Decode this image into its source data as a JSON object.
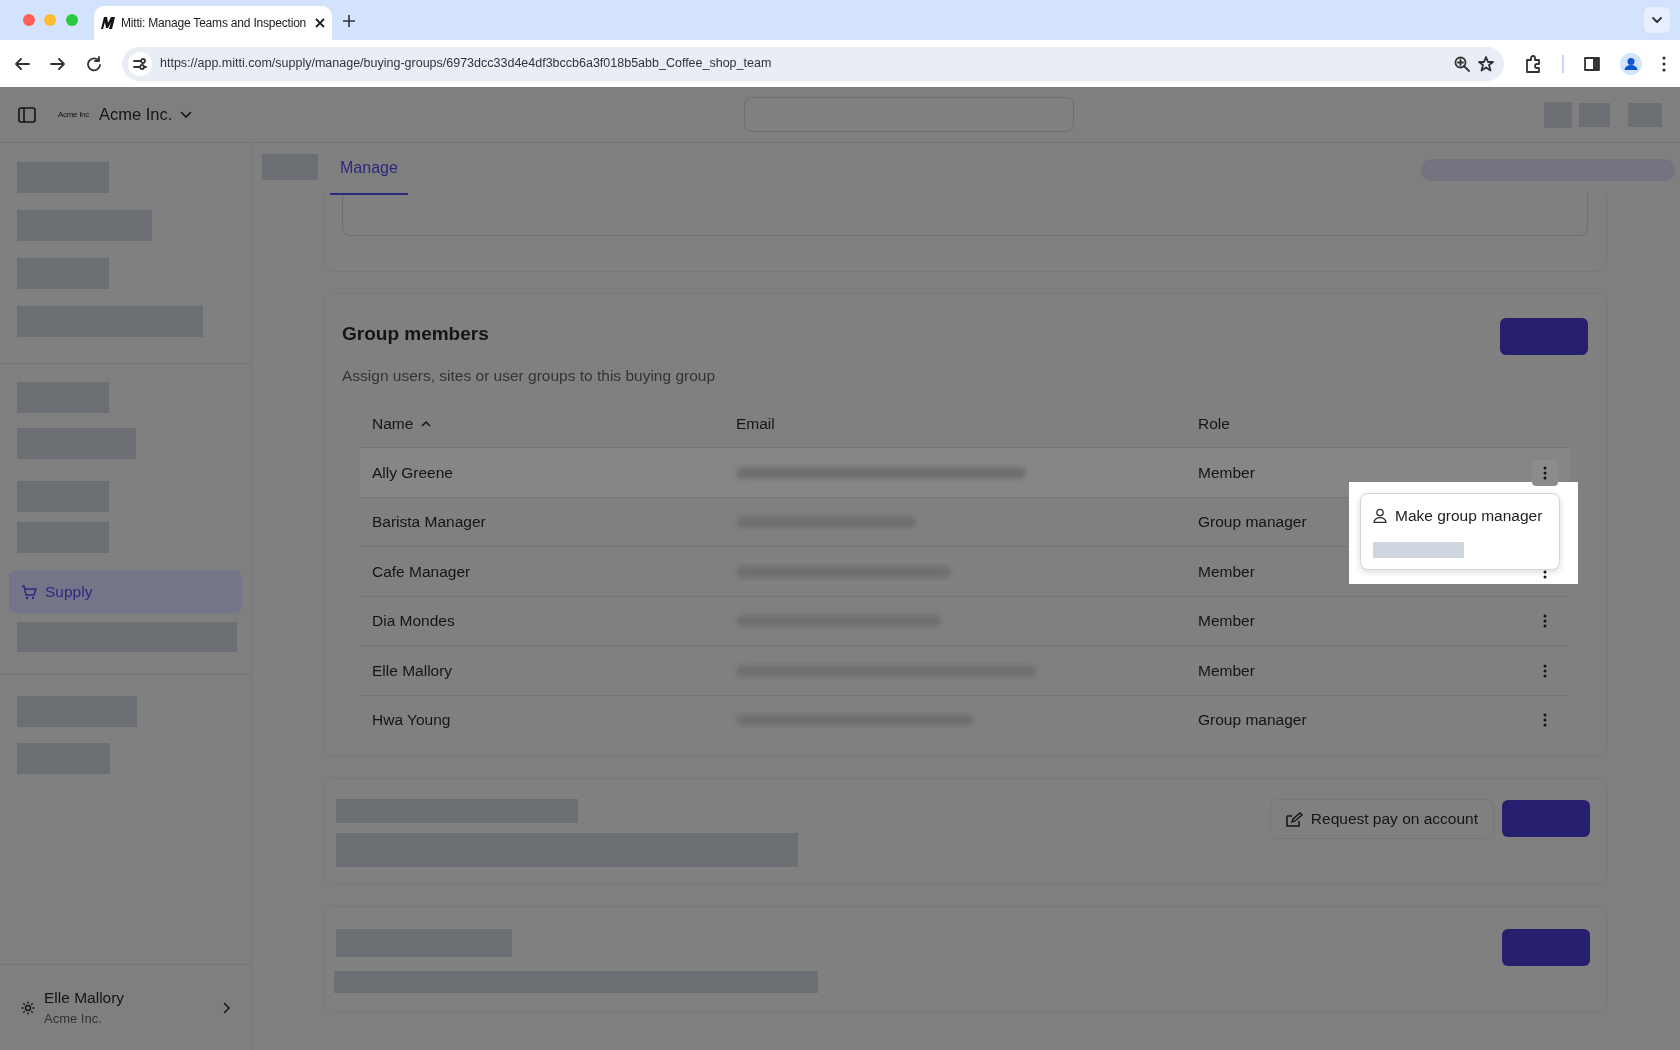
{
  "browser": {
    "tab_title": "Mitti: Manage Teams and Inspection",
    "url": "https://app.mitti.com/supply/manage/buying-groups/6973dcc33d4e4df3bccb6a3f018b5abb_Coffee_shop_team"
  },
  "header": {
    "logo_text": "Acme Inc",
    "org_name": "Acme Inc."
  },
  "sidebar": {
    "items": [
      {
        "label": "Supply",
        "selected": true
      }
    ],
    "user": {
      "name": "Elle Mallory",
      "org": "Acme Inc."
    }
  },
  "tabs": [
    {
      "label": "Manage",
      "selected": true
    }
  ],
  "group_members": {
    "title": "Group members",
    "subtitle": "Assign users, sites or user groups to this buying group",
    "columns": [
      {
        "label": "Name",
        "sorted": true
      },
      {
        "label": "Email",
        "sorted": false
      },
      {
        "label": "Role",
        "sorted": false
      }
    ],
    "rows": [
      {
        "name": "Ally Greene",
        "role": "Member",
        "menu_open": true
      },
      {
        "name": "Barista Manager",
        "role": "Group manager",
        "menu_open": false
      },
      {
        "name": "Cafe Manager",
        "role": "Member",
        "menu_open": false
      },
      {
        "name": "Dia Mondes",
        "role": "Member",
        "menu_open": false
      },
      {
        "name": "Elle Mallory",
        "role": "Member",
        "menu_open": false
      },
      {
        "name": "Hwa Young",
        "role": "Group manager",
        "menu_open": false
      }
    ],
    "row_menu": {
      "items": [
        {
          "label": "Make group manager"
        }
      ]
    }
  },
  "payment": {
    "request_button": "Request pay on account"
  }
}
